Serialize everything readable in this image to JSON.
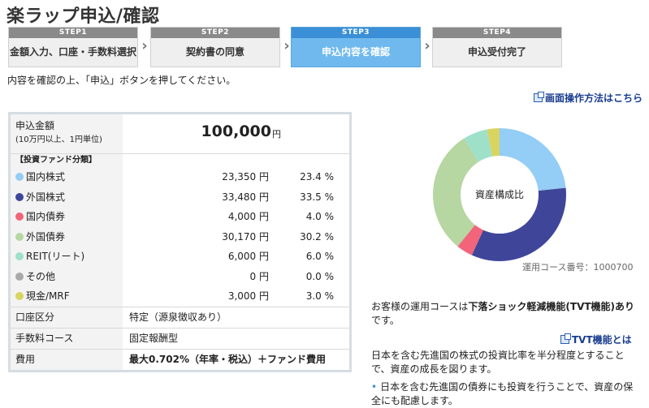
{
  "page_title": "楽ラップ申込/確認",
  "steps": [
    {
      "num": "STEP1",
      "label": "金額入力、口座・手数料選択"
    },
    {
      "num": "STEP2",
      "label": "契約書の同意"
    },
    {
      "num": "STEP3",
      "label": "申込内容を確認"
    },
    {
      "num": "STEP4",
      "label": "申込受付完了"
    }
  ],
  "active_step": 3,
  "instruction": "内容を確認の上、「申込」ボタンを押してください。",
  "help_link": "画面操作方法はこちら",
  "amount": {
    "label": "申込金額",
    "sub": "(10万円以上、1円単位)",
    "value": "100,000",
    "unit": "円"
  },
  "fund_header": "【投資ファンド分類】",
  "funds": [
    {
      "name": "国内株式",
      "yen": "23,350 円",
      "pct": "23.4 %",
      "color": "#94cdf5",
      "value": 23.4
    },
    {
      "name": "外国株式",
      "yen": "33,480 円",
      "pct": "33.5 %",
      "color": "#3f469a",
      "value": 33.5
    },
    {
      "name": "国内債券",
      "yen": "4,000 円",
      "pct": "4.0 %",
      "color": "#f2647a",
      "value": 4.0
    },
    {
      "name": "外国債券",
      "yen": "30,170 円",
      "pct": "30.2 %",
      "color": "#b6d6a2",
      "value": 30.2
    },
    {
      "name": "REIT(リート)",
      "yen": "6,000 円",
      "pct": "6.0 %",
      "color": "#9fe0c9",
      "value": 6.0
    },
    {
      "name": "その他",
      "yen": "0 円",
      "pct": "0.0 %",
      "color": "#a9a9a9",
      "value": 0.0
    },
    {
      "name": "現金/MRF",
      "yen": "3,000 円",
      "pct": "3.0 %",
      "color": "#d9d460",
      "value": 3.0
    }
  ],
  "account": {
    "label": "口座区分",
    "value": "特定（源泉徴収あり）"
  },
  "fee_course": {
    "label": "手数料コース",
    "value": "固定報酬型"
  },
  "cost": {
    "label": "費用",
    "value": "最大0.702%（年率・税込）＋ファンド費用"
  },
  "chart_data": {
    "type": "pie",
    "style": "donut",
    "title": "資産構成比",
    "categories": [
      "国内株式",
      "外国株式",
      "国内債券",
      "外国債券",
      "REIT(リート)",
      "その他",
      "現金/MRF"
    ],
    "values": [
      23.4,
      33.5,
      4.0,
      30.2,
      6.0,
      0.0,
      3.0
    ],
    "colors": [
      "#94cdf5",
      "#3f469a",
      "#f2647a",
      "#b6d6a2",
      "#9fe0c9",
      "#a9a9a9",
      "#d9d460"
    ]
  },
  "course_number": "運用コース番号：1000700",
  "tvt": {
    "prefix": "お客様の運用コースは",
    "bold": "下落ショック軽減機能(TVT機能)あり",
    "suffix": "です。",
    "link": "TVT機能とは",
    "desc": "日本を含む先進国の株式の投資比率を半分程度とすることで、資産の成長を図ります。",
    "bullet": "日本を含む先進国の債券にも投資を行うことで、資産の保全にも配慮します。"
  }
}
